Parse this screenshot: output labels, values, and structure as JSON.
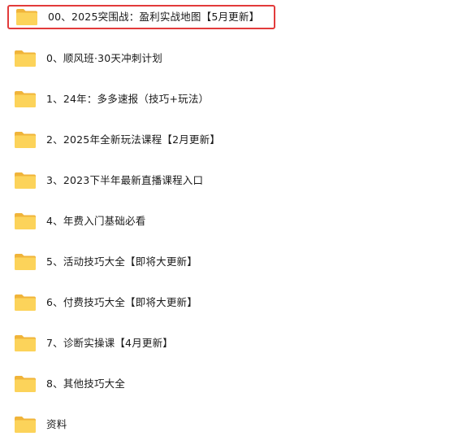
{
  "folders": [
    {
      "label": "00、2025突围战：盈利实战地图【5月更新】",
      "selected": true
    },
    {
      "label": "0、顺风班·30天冲刺计划"
    },
    {
      "label": "1、24年：多多速报（技巧+玩法）"
    },
    {
      "label": "2、2025年全新玩法课程【2月更新】"
    },
    {
      "label": "3、2023下半年最新直播课程入口"
    },
    {
      "label": "4、年费入门基础必看"
    },
    {
      "label": "5、活动技巧大全【即将大更新】"
    },
    {
      "label": "6、付费技巧大全【即将大更新】"
    },
    {
      "label": "7、诊断实操课【4月更新】"
    },
    {
      "label": "8、其他技巧大全"
    },
    {
      "label": "资料"
    }
  ],
  "colors": {
    "folder_back": "#f0b43a",
    "folder_front": "#fcd35a",
    "selection_border": "#e23b3b"
  },
  "icon": "folder-icon"
}
